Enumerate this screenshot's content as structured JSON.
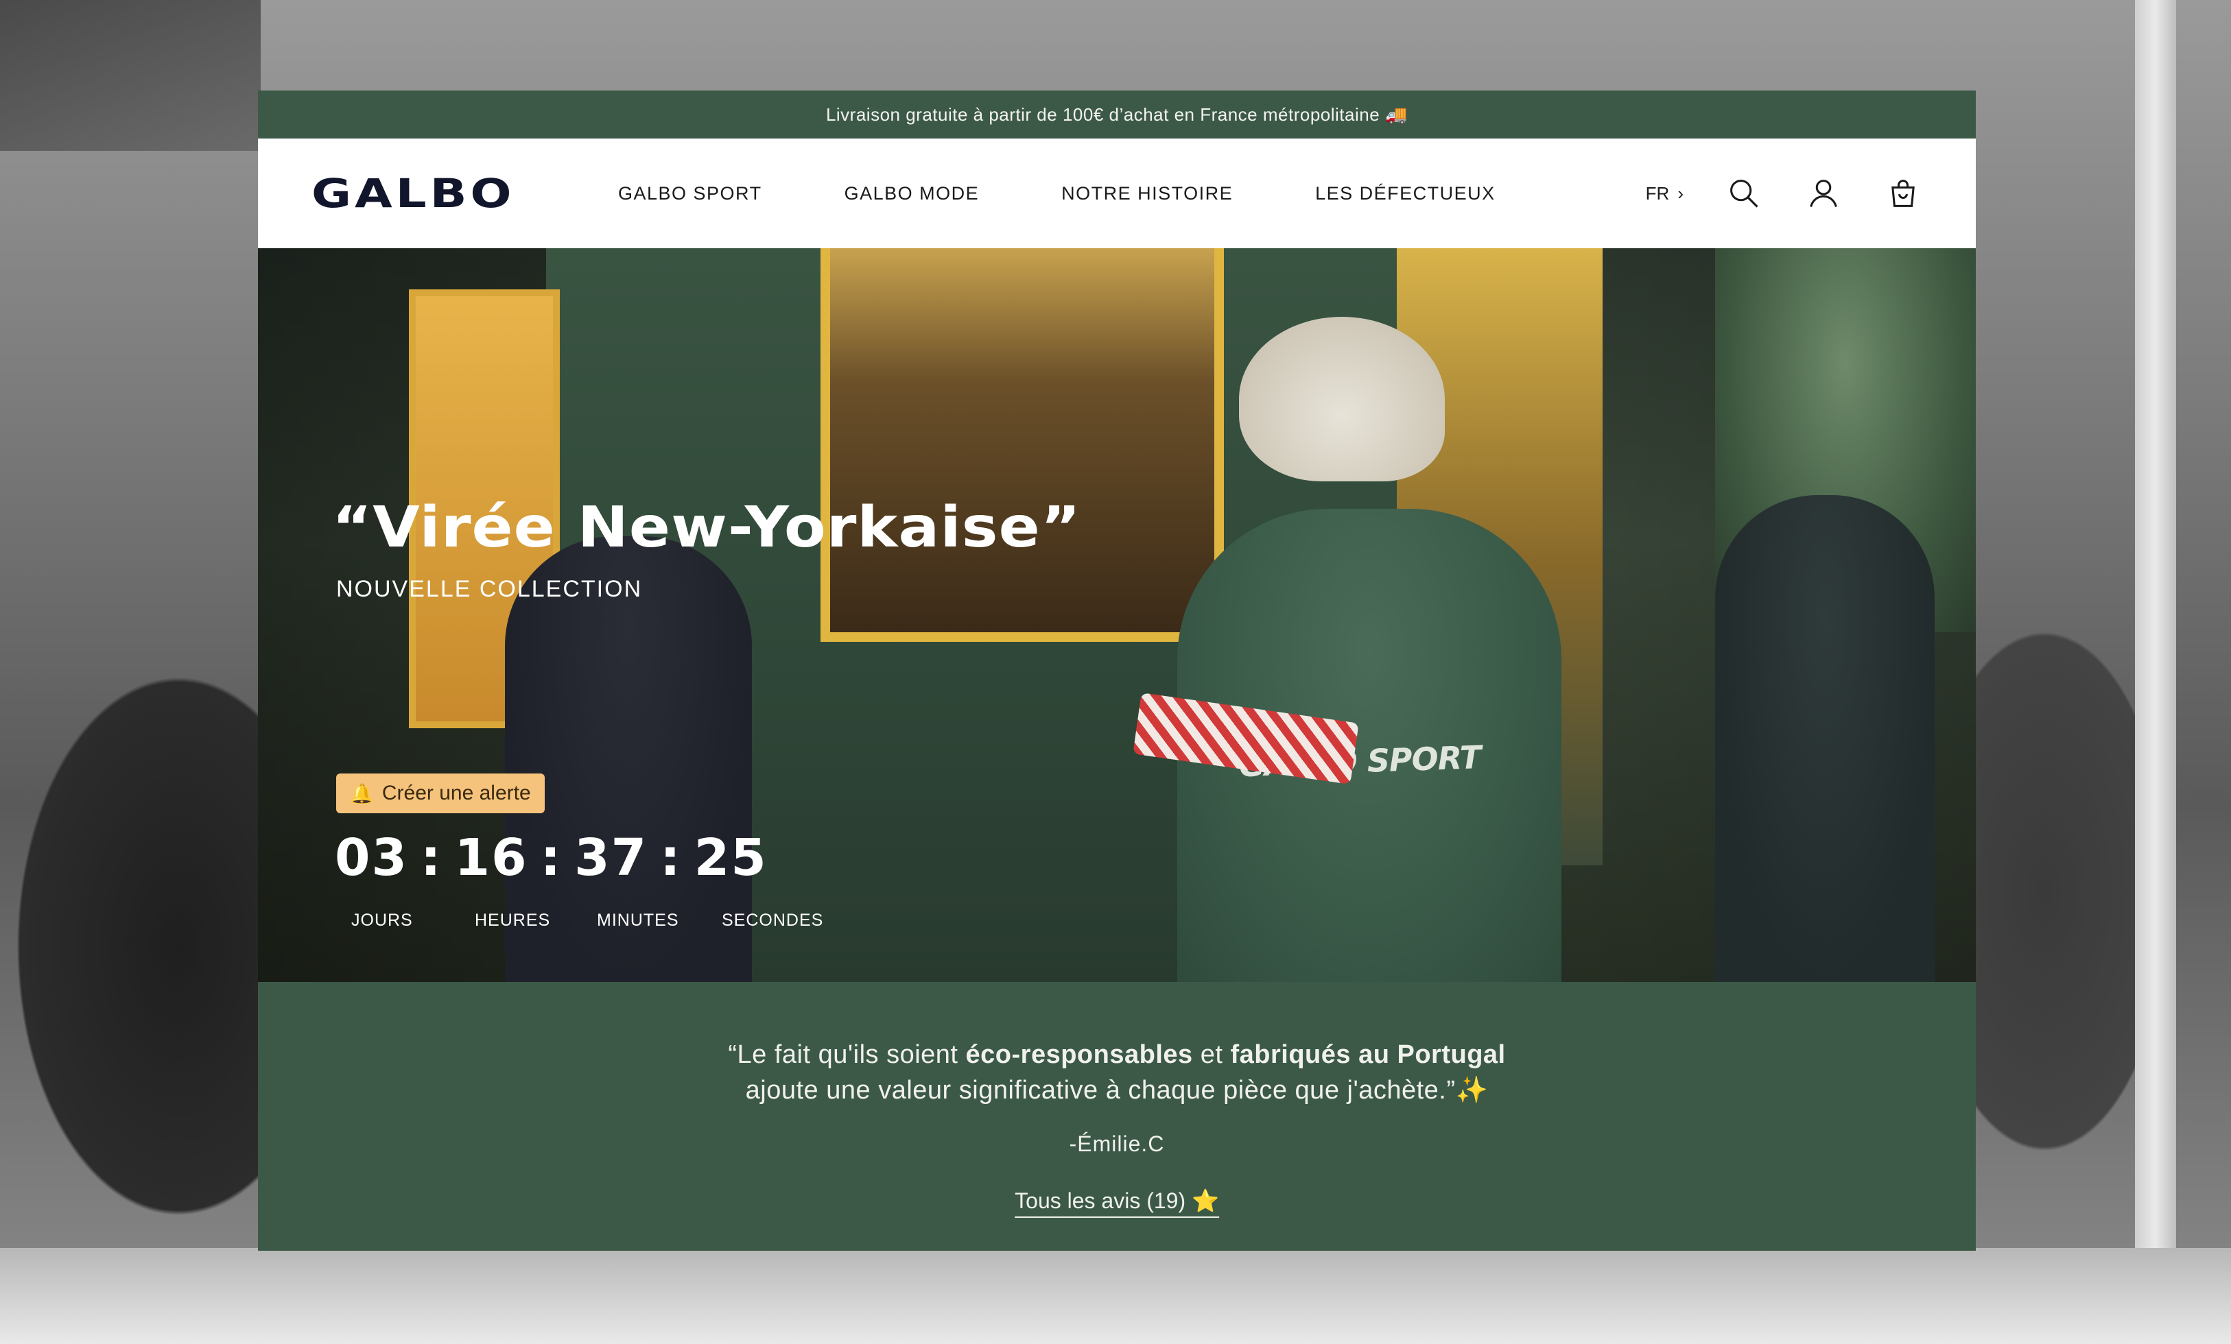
{
  "announcement": {
    "text": "Livraison gratuite à partir de 100€ d’achat en France métropolitaine",
    "icon": "🚚"
  },
  "header": {
    "logo": "GALBO",
    "nav": [
      {
        "label": "GALBO SPORT"
      },
      {
        "label": "GALBO MODE"
      },
      {
        "label": "NOTRE HISTOIRE"
      },
      {
        "label": "LES DÉFECTUEUX"
      }
    ],
    "language": "FR",
    "language_chevron": "›",
    "icons": [
      "search-icon",
      "account-icon",
      "cart-icon"
    ]
  },
  "hero": {
    "title": "“Virée New-Yorkaise”",
    "subtitle": "NOUVELLE COLLECTION",
    "alert_button": "Créer une alerte",
    "alert_icon": "🔔",
    "shirt_print": "GALBO SPORT",
    "countdown": {
      "days": "03",
      "hours": "16",
      "minutes": "37",
      "seconds": "25",
      "separator": ":",
      "labels": {
        "days": "JOURS",
        "hours": "HEURES",
        "minutes": "MINUTES",
        "seconds": "SECONDES"
      }
    }
  },
  "testimonial": {
    "quote_open": "“Le fait qu'ils soient ",
    "bold_1": "éco-responsables",
    "mid": " et ",
    "bold_2": "fabriqués au Portugal",
    "line_2": "ajoute une valeur significative à chaque pièce que j'achète.”",
    "sparkle": "✨",
    "author": "-Émilie.C",
    "reviews_link": "Tous les avis (19)",
    "reviews_star": "⭐"
  },
  "colors": {
    "brand_green": "#3c5948",
    "logo_navy": "#12162c",
    "alert_orange": "#f6c37c"
  }
}
